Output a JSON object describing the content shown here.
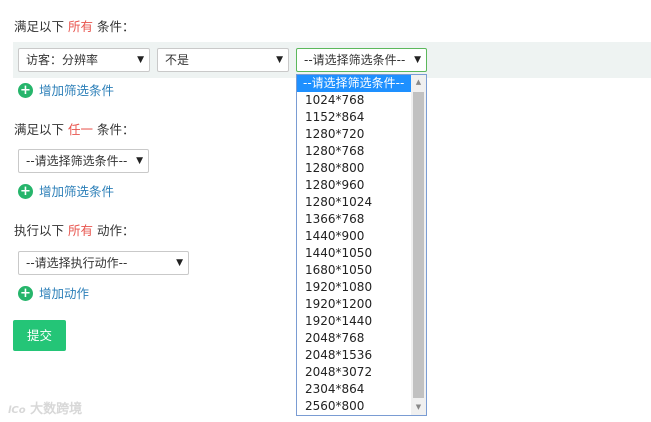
{
  "section_all": {
    "prefix": "满足以下",
    "highlight": "所有",
    "suffix": "条件："
  },
  "filter_row": {
    "field_select": "访客：分辨率",
    "operator_select": "不是",
    "value_select": "--请选择筛选条件--"
  },
  "add_filter_1": "增加筛选条件",
  "section_any": {
    "prefix": "满足以下",
    "highlight": "任一",
    "suffix": "条件："
  },
  "any_select": "--请选择筛选条件--",
  "add_filter_2": "增加筛选条件",
  "section_action": {
    "prefix": "执行以下",
    "highlight": "所有",
    "suffix": "动作："
  },
  "action_select": "--请选择执行动作--",
  "add_action": "增加动作",
  "submit_label": "提交",
  "dropdown_options": [
    "--请选择筛选条件--",
    "1024*768",
    "1152*864",
    "1280*720",
    "1280*768",
    "1280*800",
    "1280*960",
    "1280*1024",
    "1366*768",
    "1440*900",
    "1440*1050",
    "1680*1050",
    "1920*1080",
    "1920*1200",
    "1920*1440",
    "2048*768",
    "2048*1536",
    "2048*3072",
    "2304*864",
    "2560*800"
  ],
  "watermark": "大数跨境",
  "colors": {
    "highlight": "#e8554e",
    "link": "#2c7fb8",
    "green": "#24c577",
    "selected": "#1e90ff"
  }
}
